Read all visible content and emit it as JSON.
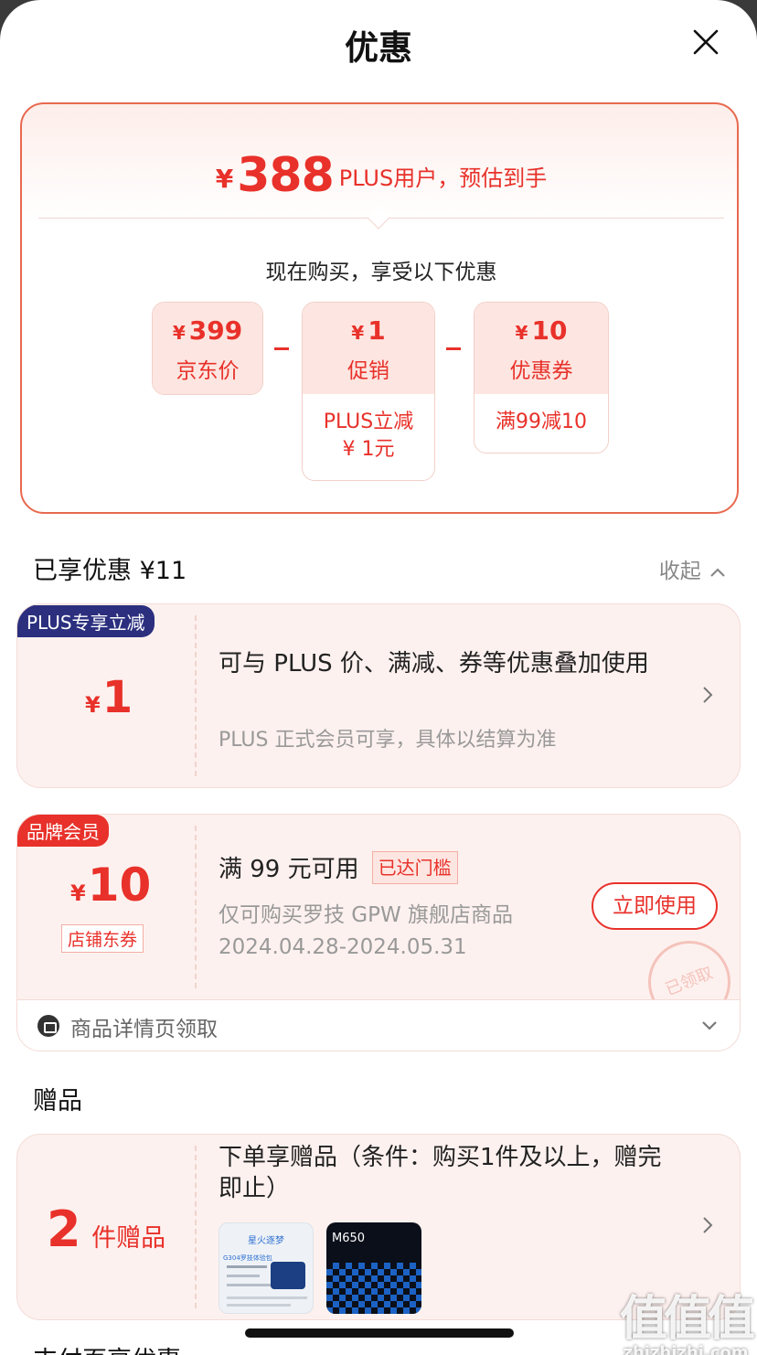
{
  "header": {
    "title": "优惠"
  },
  "summary": {
    "currency": "¥",
    "estimated_price": "388",
    "estimated_label": "PLUS用户，预估到手",
    "buy_now_text": "现在购买，享受以下优惠",
    "jd_price": {
      "amount": "399",
      "label": "京东价"
    },
    "promo": {
      "amount": "1",
      "label": "促销",
      "note": "PLUS立减\n¥ 1元"
    },
    "coupon": {
      "amount": "10",
      "label": "优惠券",
      "note": "满99减10"
    }
  },
  "enjoyed": {
    "title": "已享优惠 ¥11",
    "collapse_label": "收起"
  },
  "plus_card": {
    "tag": "PLUS专享立减",
    "amount": "1",
    "desc": "可与 PLUS 价、满减、券等优惠叠加使用",
    "subdesc": "PLUS 正式会员可享，具体以结算为准"
  },
  "coupon_card": {
    "tag": "品牌会员",
    "amount": "10",
    "shop_tag": "店铺东券",
    "condition": "满 99 元可用",
    "reached_badge": "已达门槛",
    "scope": "仅可购买罗技 GPW 旗舰店商品",
    "validity": "2024.04.28-2024.05.31",
    "use_button": "立即使用",
    "stamp": "已领取",
    "footer_text": "商品详情页领取"
  },
  "gift": {
    "section_title": "赠品",
    "count": "2",
    "count_label": "件赠品",
    "desc": "下单享赠品（条件：购买1件及以上，赠完即止）",
    "images": [
      {
        "title": "星火逐梦",
        "subtitle": "G304罗技体验包"
      },
      {
        "title": "M650"
      }
    ]
  },
  "watermark": {
    "main": "值值值",
    "sub": "zhizhizhi.com"
  },
  "next_section_peek": "支付页享优惠",
  "colors": {
    "accent_red": "#e8312a",
    "plus_navy": "#2b2f7e",
    "card_bg": "#fdf1ef"
  }
}
